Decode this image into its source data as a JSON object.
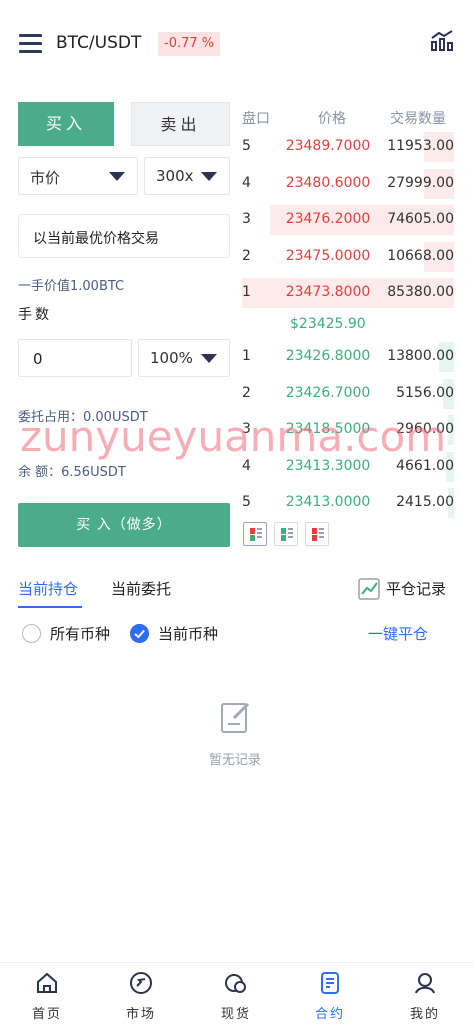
{
  "header": {
    "pair": "BTC/USDT",
    "change": "-0.77 %",
    "menu_icon": "menu-icon",
    "chart_icon": "chart-icon"
  },
  "form": {
    "tab_buy": "买入",
    "tab_sell": "卖出",
    "order_type": "市价",
    "leverage": "300x",
    "price_text": "以当前最优价格交易",
    "lot_value": "一手价值1.00BTC",
    "qty_label": "手数",
    "qty_value": "0",
    "qty_percent": "100%",
    "margin_used": "委托占用：0.00USDT",
    "balance": "余 额：6.56USDT",
    "buy_button": "买 入（做多）"
  },
  "orderbook": {
    "headers": {
      "level": "盘口",
      "price": "价格",
      "qty": "交易数量"
    },
    "asks": [
      {
        "level": "5",
        "price": "23489.7000",
        "qty": "11953.00",
        "depth": 0.14
      },
      {
        "level": "4",
        "price": "23480.6000",
        "qty": "27999.00",
        "depth": 0.14
      },
      {
        "level": "3",
        "price": "23476.2000",
        "qty": "74605.00",
        "depth": 0.87
      },
      {
        "level": "2",
        "price": "23475.0000",
        "qty": "10668.00",
        "depth": 0.14
      },
      {
        "level": "1",
        "price": "23473.8000",
        "qty": "85380.00",
        "depth": 1.0
      }
    ],
    "mid_price": "$23425.90",
    "bids": [
      {
        "level": "1",
        "price": "23426.8000",
        "qty": "13800.00",
        "depth": 0.07
      },
      {
        "level": "2",
        "price": "23426.7000",
        "qty": "5156.00",
        "depth": 0.05
      },
      {
        "level": "3",
        "price": "23418.5000",
        "qty": "2960.00",
        "depth": 0.03
      },
      {
        "level": "4",
        "price": "23413.3000",
        "qty": "4661.00",
        "depth": 0.04
      },
      {
        "level": "5",
        "price": "23413.0000",
        "qty": "2415.00",
        "depth": 0.03
      }
    ],
    "colors": {
      "ask": "#e0413e",
      "bid": "#3fae7b"
    }
  },
  "watermark": "zunyueyuanma.com",
  "positions": {
    "tab_positions": "当前持仓",
    "tab_orders": "当前委托",
    "history": "平仓记录",
    "filter_all": "所有币种",
    "filter_current": "当前币种",
    "close_all": "一键平仓",
    "empty": "暂无记录"
  },
  "nav": {
    "items": [
      {
        "label": "首页",
        "icon": "home-icon"
      },
      {
        "label": "市场",
        "icon": "market-icon"
      },
      {
        "label": "现货",
        "icon": "spot-icon"
      },
      {
        "label": "合约",
        "icon": "contract-icon"
      },
      {
        "label": "我的",
        "icon": "profile-icon"
      }
    ],
    "active_color": "#2f6df3"
  }
}
